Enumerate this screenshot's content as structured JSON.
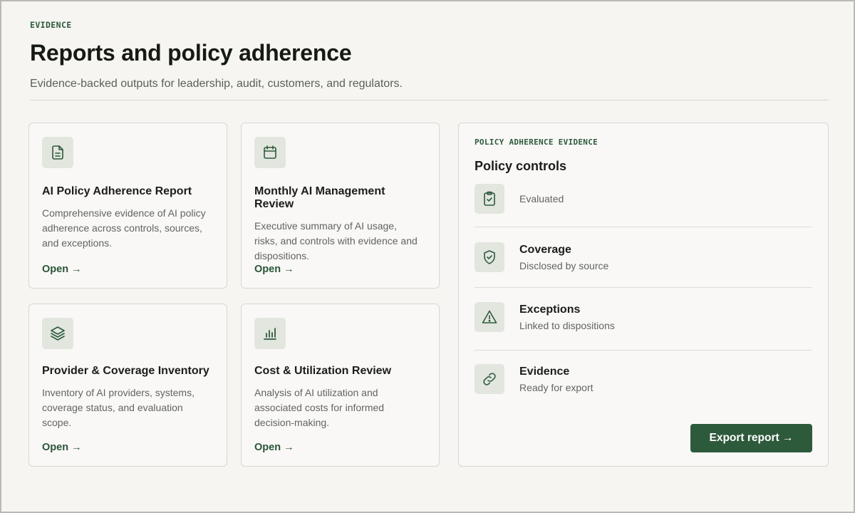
{
  "header": {
    "eyebrow": "EVIDENCE",
    "title": "Reports and policy adherence",
    "subtitle": "Evidence-backed outputs for leadership, audit, customers, and regulators."
  },
  "reports": [
    {
      "icon": "document-icon",
      "title": "AI Policy Adherence Report",
      "description": "Comprehensive evidence of AI policy adherence across controls, sources, and exceptions.",
      "link": "Open →"
    },
    {
      "icon": "calendar-icon",
      "title": "Monthly AI Management Review",
      "description": "Executive summary of AI usage, risks, and controls with evidence and dispositions.",
      "link": "Open →"
    },
    {
      "icon": "layers-icon",
      "title": "Provider & Coverage Inventory",
      "description": "Inventory of AI providers, systems, coverage status, and evaluation scope.",
      "link": "Open →"
    },
    {
      "icon": "bar-chart-icon",
      "title": "Cost & Utilization Review",
      "description": "Analysis of AI utilization and associated costs for informed decision-making.",
      "link": "Open →"
    }
  ],
  "panel": {
    "eyebrow": "POLICY ADHERENCE EVIDENCE",
    "title": "Policy controls",
    "controls": [
      {
        "icon": "clipboard-check-icon",
        "name": "",
        "description": "Evaluated"
      },
      {
        "icon": "shield-check-icon",
        "name": "Coverage",
        "description": "Disclosed by source"
      },
      {
        "icon": "warning-icon",
        "name": "Exceptions",
        "description": "Linked to dispositions"
      },
      {
        "icon": "link-icon",
        "name": "Evidence",
        "description": "Ready for export"
      }
    ],
    "export_label": "Export report →"
  },
  "colors": {
    "accent": "#2e5a3c",
    "background": "#f6f5f2",
    "icon_bg": "#e2e6de"
  }
}
